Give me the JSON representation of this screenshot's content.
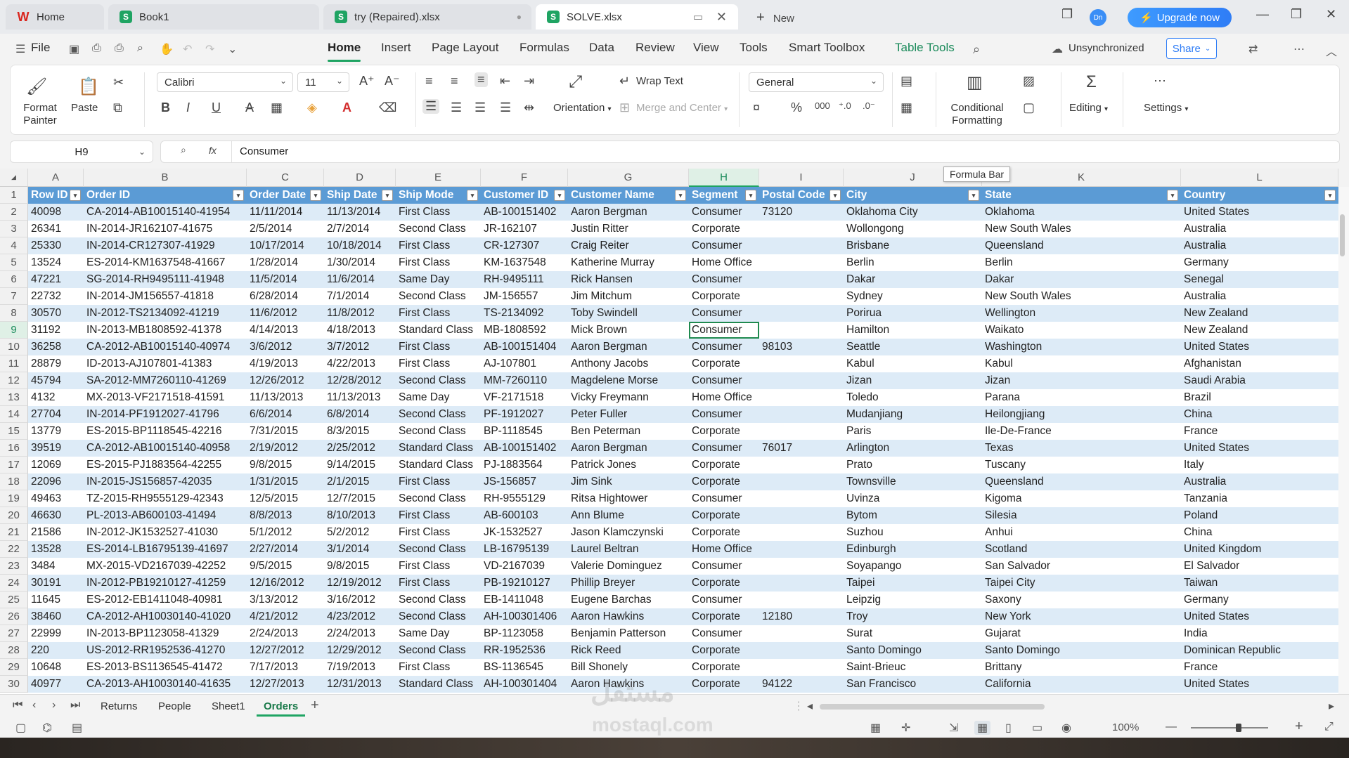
{
  "titlebar": {
    "tabs": [
      {
        "label": "Home",
        "logo": "W"
      },
      {
        "label": "Book1",
        "logo": "S"
      },
      {
        "label": "try (Repaired).xlsx",
        "logo": "S"
      },
      {
        "label": "SOLVE.xlsx",
        "logo": "S"
      }
    ],
    "new_label": "New",
    "avatar_text": "Dn",
    "upgrade_label": "Upgrade now"
  },
  "menu": {
    "file": "File",
    "items": [
      "Home",
      "Insert",
      "Page Layout",
      "Formulas",
      "Data",
      "Review",
      "View",
      "Tools",
      "Smart Toolbox",
      "Table Tools"
    ],
    "sync_status": "Unsynchronized",
    "share": "Share"
  },
  "ribbon": {
    "format_painter": "Format Painter",
    "paste": "Paste",
    "font_name": "Calibri",
    "font_size": "11",
    "wrap_text": "Wrap Text",
    "orientation": "Orientation",
    "merge_center": "Merge and Center",
    "number_format": "General",
    "conditional_formatting": "Conditional Formatting",
    "editing": "Editing",
    "settings": "Settings"
  },
  "formula_bar": {
    "cell_ref": "H9",
    "fx": "fx",
    "content": "Consumer",
    "tooltip": "Formula Bar"
  },
  "columns": [
    "A",
    "B",
    "C",
    "D",
    "E",
    "F",
    "G",
    "H",
    "I",
    "J",
    "K",
    "L"
  ],
  "headers": [
    "Row ID",
    "Order ID",
    "Order Date",
    "Ship Date",
    "Ship Mode",
    "Customer ID",
    "Customer Name",
    "Segment",
    "Postal Code",
    "City",
    "State",
    "Country"
  ],
  "rows": [
    [
      "40098",
      "CA-2014-AB10015140-41954",
      "11/11/2014",
      "11/13/2014",
      "First Class",
      "AB-100151402",
      "Aaron Bergman",
      "Consumer",
      "73120",
      "Oklahoma City",
      "Oklahoma",
      "United States"
    ],
    [
      "26341",
      "IN-2014-JR162107-41675",
      "2/5/2014",
      "2/7/2014",
      "Second Class",
      "JR-162107",
      "Justin Ritter",
      "Corporate",
      "",
      "Wollongong",
      "New South Wales",
      "Australia"
    ],
    [
      "25330",
      "IN-2014-CR127307-41929",
      "10/17/2014",
      "10/18/2014",
      "First Class",
      "CR-127307",
      "Craig Reiter",
      "Consumer",
      "",
      "Brisbane",
      "Queensland",
      "Australia"
    ],
    [
      "13524",
      "ES-2014-KM1637548-41667",
      "1/28/2014",
      "1/30/2014",
      "First Class",
      "KM-1637548",
      "Katherine Murray",
      "Home Office",
      "",
      "Berlin",
      "Berlin",
      "Germany"
    ],
    [
      "47221",
      "SG-2014-RH9495111-41948",
      "11/5/2014",
      "11/6/2014",
      "Same Day",
      "RH-9495111",
      "Rick Hansen",
      "Consumer",
      "",
      "Dakar",
      "Dakar",
      "Senegal"
    ],
    [
      "22732",
      "IN-2014-JM156557-41818",
      "6/28/2014",
      "7/1/2014",
      "Second Class",
      "JM-156557",
      "Jim Mitchum",
      "Corporate",
      "",
      "Sydney",
      "New South Wales",
      "Australia"
    ],
    [
      "30570",
      "IN-2012-TS2134092-41219",
      "11/6/2012",
      "11/8/2012",
      "First Class",
      "TS-2134092",
      "Toby Swindell",
      "Consumer",
      "",
      "Porirua",
      "Wellington",
      "New Zealand"
    ],
    [
      "31192",
      "IN-2013-MB1808592-41378",
      "4/14/2013",
      "4/18/2013",
      "Standard Class",
      "MB-1808592",
      "Mick Brown",
      "Consumer",
      "",
      "Hamilton",
      "Waikato",
      "New Zealand"
    ],
    [
      "36258",
      "CA-2012-AB10015140-40974",
      "3/6/2012",
      "3/7/2012",
      "First Class",
      "AB-100151404",
      "Aaron Bergman",
      "Consumer",
      "98103",
      "Seattle",
      "Washington",
      "United States"
    ],
    [
      "28879",
      "ID-2013-AJ107801-41383",
      "4/19/2013",
      "4/22/2013",
      "First Class",
      "AJ-107801",
      "Anthony Jacobs",
      "Corporate",
      "",
      "Kabul",
      "Kabul",
      "Afghanistan"
    ],
    [
      "45794",
      "SA-2012-MM7260110-41269",
      "12/26/2012",
      "12/28/2012",
      "Second Class",
      "MM-7260110",
      "Magdelene Morse",
      "Consumer",
      "",
      "Jizan",
      "Jizan",
      "Saudi Arabia"
    ],
    [
      "4132",
      "MX-2013-VF2171518-41591",
      "11/13/2013",
      "11/13/2013",
      "Same Day",
      "VF-2171518",
      "Vicky Freymann",
      "Home Office",
      "",
      "Toledo",
      "Parana",
      "Brazil"
    ],
    [
      "27704",
      "IN-2014-PF1912027-41796",
      "6/6/2014",
      "6/8/2014",
      "Second Class",
      "PF-1912027",
      "Peter Fuller",
      "Consumer",
      "",
      "Mudanjiang",
      "Heilongjiang",
      "China"
    ],
    [
      "13779",
      "ES-2015-BP1118545-42216",
      "7/31/2015",
      "8/3/2015",
      "Second Class",
      "BP-1118545",
      "Ben Peterman",
      "Corporate",
      "",
      "Paris",
      "Ile-De-France",
      "France"
    ],
    [
      "39519",
      "CA-2012-AB10015140-40958",
      "2/19/2012",
      "2/25/2012",
      "Standard Class",
      "AB-100151402",
      "Aaron Bergman",
      "Consumer",
      "76017",
      "Arlington",
      "Texas",
      "United States"
    ],
    [
      "12069",
      "ES-2015-PJ1883564-42255",
      "9/8/2015",
      "9/14/2015",
      "Standard Class",
      "PJ-1883564",
      "Patrick Jones",
      "Corporate",
      "",
      "Prato",
      "Tuscany",
      "Italy"
    ],
    [
      "22096",
      "IN-2015-JS156857-42035",
      "1/31/2015",
      "2/1/2015",
      "First Class",
      "JS-156857",
      "Jim Sink",
      "Corporate",
      "",
      "Townsville",
      "Queensland",
      "Australia"
    ],
    [
      "49463",
      "TZ-2015-RH9555129-42343",
      "12/5/2015",
      "12/7/2015",
      "Second Class",
      "RH-9555129",
      "Ritsa Hightower",
      "Consumer",
      "",
      "Uvinza",
      "Kigoma",
      "Tanzania"
    ],
    [
      "46630",
      "PL-2013-AB600103-41494",
      "8/8/2013",
      "8/10/2013",
      "First Class",
      "AB-600103",
      "Ann Blume",
      "Corporate",
      "",
      "Bytom",
      "Silesia",
      "Poland"
    ],
    [
      "21586",
      "IN-2012-JK1532527-41030",
      "5/1/2012",
      "5/2/2012",
      "First Class",
      "JK-1532527",
      "Jason Klamczynski",
      "Corporate",
      "",
      "Suzhou",
      "Anhui",
      "China"
    ],
    [
      "13528",
      "ES-2014-LB16795139-41697",
      "2/27/2014",
      "3/1/2014",
      "Second Class",
      "LB-16795139",
      "Laurel Beltran",
      "Home Office",
      "",
      "Edinburgh",
      "Scotland",
      "United Kingdom"
    ],
    [
      "3484",
      "MX-2015-VD2167039-42252",
      "9/5/2015",
      "9/8/2015",
      "First Class",
      "VD-2167039",
      "Valerie Dominguez",
      "Consumer",
      "",
      "Soyapango",
      "San Salvador",
      "El Salvador"
    ],
    [
      "30191",
      "IN-2012-PB19210127-41259",
      "12/16/2012",
      "12/19/2012",
      "First Class",
      "PB-19210127",
      "Phillip Breyer",
      "Corporate",
      "",
      "Taipei",
      "Taipei City",
      "Taiwan"
    ],
    [
      "11645",
      "ES-2012-EB1411048-40981",
      "3/13/2012",
      "3/16/2012",
      "Second Class",
      "EB-1411048",
      "Eugene Barchas",
      "Consumer",
      "",
      "Leipzig",
      "Saxony",
      "Germany"
    ],
    [
      "38460",
      "CA-2012-AH10030140-41020",
      "4/21/2012",
      "4/23/2012",
      "Second Class",
      "AH-100301406",
      "Aaron Hawkins",
      "Corporate",
      "12180",
      "Troy",
      "New York",
      "United States"
    ],
    [
      "22999",
      "IN-2013-BP1123058-41329",
      "2/24/2013",
      "2/24/2013",
      "Same Day",
      "BP-1123058",
      "Benjamin Patterson",
      "Consumer",
      "",
      "Surat",
      "Gujarat",
      "India"
    ],
    [
      "220",
      "US-2012-RR1952536-41270",
      "12/27/2012",
      "12/29/2012",
      "Second Class",
      "RR-1952536",
      "Rick Reed",
      "Corporate",
      "",
      "Santo Domingo",
      "Santo Domingo",
      "Dominican Republic"
    ],
    [
      "10648",
      "ES-2013-BS1136545-41472",
      "7/17/2013",
      "7/19/2013",
      "First Class",
      "BS-1136545",
      "Bill Shonely",
      "Corporate",
      "",
      "Saint-Brieuc",
      "Brittany",
      "France"
    ],
    [
      "40977",
      "CA-2013-AH10030140-41635",
      "12/27/2013",
      "12/31/2013",
      "Standard Class",
      "AH-100301404",
      "Aaron Hawkins",
      "Corporate",
      "94122",
      "San Francisco",
      "California",
      "United States"
    ]
  ],
  "selected": {
    "row": 9,
    "col": "H"
  },
  "sheets": [
    "Returns",
    "People",
    "Sheet1",
    "Orders"
  ],
  "active_sheet": "Orders",
  "status": {
    "zoom": "100%"
  },
  "watermark": {
    "line1": "مستقل",
    "line2": "mostaql.com"
  },
  "colors": {
    "header_fill": "#5b9bd5",
    "band_fill": "#ddebf7",
    "accent": "#1fa463",
    "brand_blue": "#2f7df6"
  }
}
